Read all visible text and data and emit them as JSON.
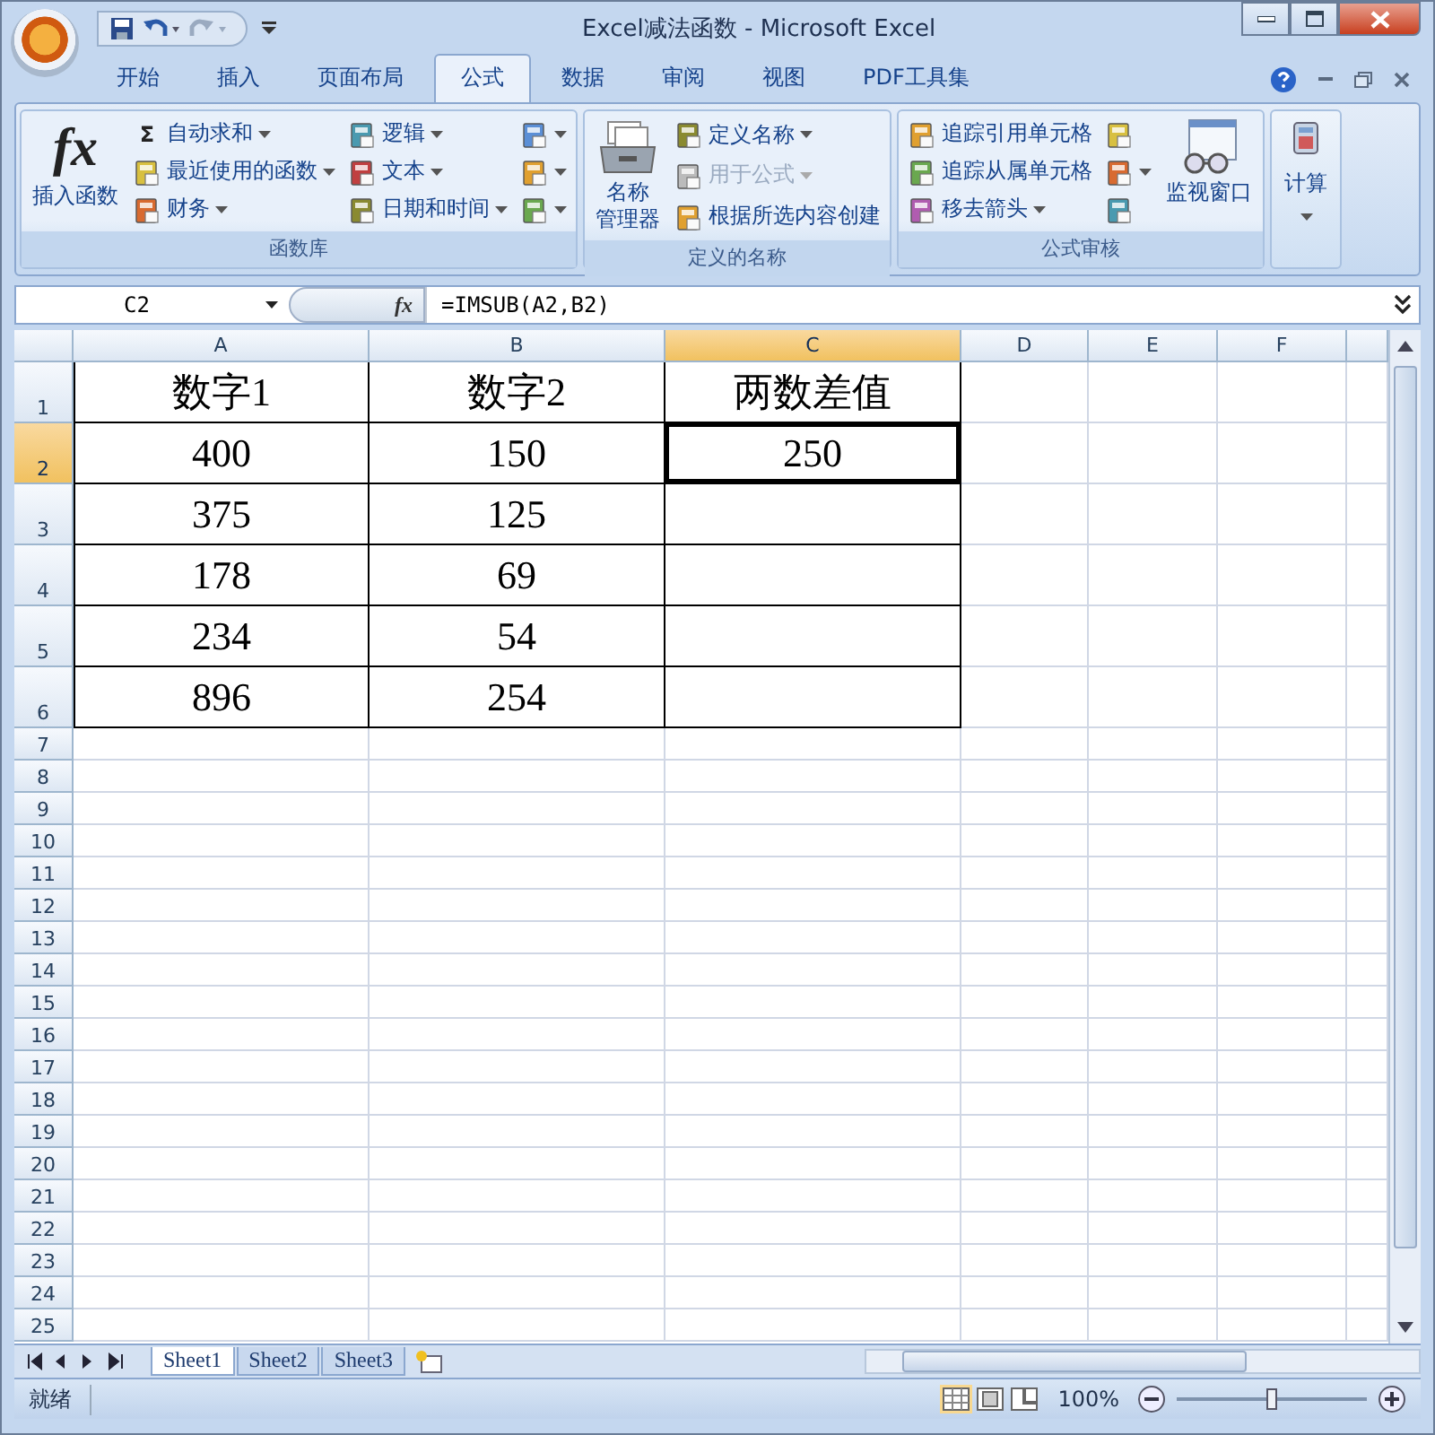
{
  "window": {
    "title": "Excel减法函数 - Microsoft Excel"
  },
  "tabs": [
    {
      "label": "开始",
      "selected": false
    },
    {
      "label": "插入",
      "selected": false
    },
    {
      "label": "页面布局",
      "selected": false
    },
    {
      "label": "公式",
      "selected": true
    },
    {
      "label": "数据",
      "selected": false
    },
    {
      "label": "审阅",
      "selected": false
    },
    {
      "label": "视图",
      "selected": false
    },
    {
      "label": "PDF工具集",
      "selected": false
    }
  ],
  "ribbon": {
    "groups": [
      {
        "kind": "group",
        "label": "函数库",
        "parts": [
          {
            "kind": "large",
            "lines": [
              "插入函数"
            ],
            "glyph": "fx"
          },
          {
            "kind": "column",
            "items": [
              {
                "label": "自动求和",
                "glyph": "Σ",
                "dropdown": true,
                "disabled": false
              },
              {
                "label": "最近使用的函数",
                "dropdown": true,
                "disabled": false
              },
              {
                "label": "财务",
                "dropdown": true,
                "disabled": false
              }
            ]
          },
          {
            "kind": "column",
            "items": [
              {
                "label": "逻辑",
                "dropdown": true,
                "disabled": false
              },
              {
                "label": "文本",
                "dropdown": true,
                "disabled": false
              },
              {
                "label": "日期和时间",
                "dropdown": true,
                "disabled": false
              }
            ]
          },
          {
            "kind": "column",
            "items": [
              {
                "dropdown": true,
                "disabled": false
              },
              {
                "dropdown": true,
                "disabled": false
              },
              {
                "dropdown": true,
                "disabled": false
              }
            ]
          }
        ]
      },
      {
        "kind": "group",
        "label": "定义的名称",
        "parts": [
          {
            "kind": "large",
            "lines": [
              "名称",
              "管理器"
            ]
          },
          {
            "kind": "column",
            "items": [
              {
                "label": "定义名称",
                "dropdown": true,
                "disabled": false
              },
              {
                "label": "用于公式",
                "dropdown": true,
                "disabled": true
              },
              {
                "label": "根据所选内容创建",
                "dropdown": false,
                "disabled": false
              }
            ]
          }
        ]
      },
      {
        "kind": "group",
        "label": "公式审核",
        "parts": [
          {
            "kind": "column",
            "items": [
              {
                "label": "追踪引用单元格",
                "dropdown": false,
                "disabled": false
              },
              {
                "label": "追踪从属单元格",
                "dropdown": false,
                "disabled": false
              },
              {
                "label": "移去箭头",
                "dropdown": true,
                "disabled": false
              }
            ]
          },
          {
            "kind": "column",
            "items": [
              {
                "dropdown": false,
                "disabled": false
              },
              {
                "dropdown": true,
                "disabled": false
              },
              {
                "dropdown": false,
                "disabled": false
              }
            ]
          },
          {
            "kind": "large",
            "lines": [
              "监视窗口"
            ]
          }
        ]
      },
      {
        "kind": "collapsed",
        "label": "计算"
      }
    ]
  },
  "name_box": "C2",
  "formula_glyph": "fx",
  "formula": "=IMSUB(A2,B2)",
  "columns": [
    {
      "label": "A",
      "selected": false
    },
    {
      "label": "B",
      "selected": false
    },
    {
      "label": "C",
      "selected": true
    },
    {
      "label": "D",
      "selected": false
    },
    {
      "label": "E",
      "selected": false
    },
    {
      "label": "F",
      "selected": false
    }
  ],
  "rows": [
    {
      "label": "1",
      "selected": false,
      "cells": [
        {
          "text": "数字1",
          "selected": false
        },
        {
          "text": "数字2",
          "selected": false
        },
        {
          "text": "两数差值",
          "selected": false
        }
      ]
    },
    {
      "label": "2",
      "selected": true,
      "cells": [
        {
          "text": "400",
          "selected": false
        },
        {
          "text": "150",
          "selected": false
        },
        {
          "text": "250",
          "selected": true
        }
      ]
    },
    {
      "label": "3",
      "selected": false,
      "cells": [
        {
          "text": "375",
          "selected": false
        },
        {
          "text": "125",
          "selected": false
        },
        {
          "text": "",
          "selected": false
        }
      ]
    },
    {
      "label": "4",
      "selected": false,
      "cells": [
        {
          "text": "178",
          "selected": false
        },
        {
          "text": "69",
          "selected": false
        },
        {
          "text": "",
          "selected": false
        }
      ]
    },
    {
      "label": "5",
      "selected": false,
      "cells": [
        {
          "text": "234",
          "selected": false
        },
        {
          "text": "54",
          "selected": false
        },
        {
          "text": "",
          "selected": false
        }
      ]
    },
    {
      "label": "6",
      "selected": false,
      "cells": [
        {
          "text": "896",
          "selected": false
        },
        {
          "text": "254",
          "selected": false
        },
        {
          "text": "",
          "selected": false
        }
      ]
    },
    {
      "label": "7",
      "selected": false
    },
    {
      "label": "8",
      "selected": false
    },
    {
      "label": "9",
      "selected": false
    },
    {
      "label": "10",
      "selected": false
    },
    {
      "label": "11",
      "selected": false
    },
    {
      "label": "12",
      "selected": false
    },
    {
      "label": "13",
      "selected": false
    },
    {
      "label": "14",
      "selected": false
    },
    {
      "label": "15",
      "selected": false
    },
    {
      "label": "16",
      "selected": false
    },
    {
      "label": "17",
      "selected": false
    },
    {
      "label": "18",
      "selected": false
    },
    {
      "label": "19",
      "selected": false
    },
    {
      "label": "20",
      "selected": false
    },
    {
      "label": "21",
      "selected": false
    },
    {
      "label": "22",
      "selected": false
    },
    {
      "label": "23",
      "selected": false
    },
    {
      "label": "24",
      "selected": false
    },
    {
      "label": "25",
      "selected": false
    }
  ],
  "sheets": [
    {
      "label": "Sheet1",
      "selected": true
    },
    {
      "label": "Sheet2",
      "selected": false
    },
    {
      "label": "Sheet3",
      "selected": false
    }
  ],
  "status": "就绪",
  "zoom": {
    "reading": "100%",
    "level": 0.5
  }
}
